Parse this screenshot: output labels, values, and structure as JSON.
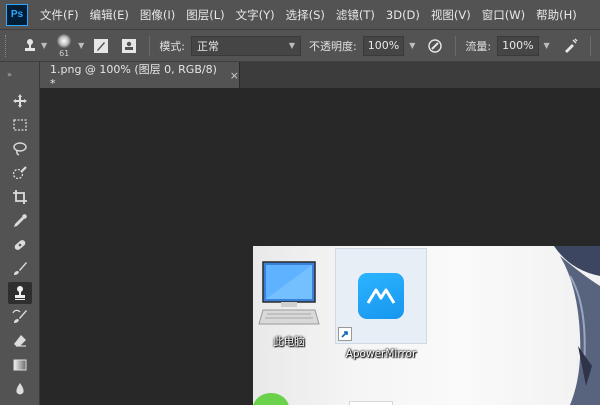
{
  "app": {
    "logo_text": "Ps"
  },
  "menu": [
    {
      "label": "文件(F)"
    },
    {
      "label": "编辑(E)"
    },
    {
      "label": "图像(I)"
    },
    {
      "label": "图层(L)"
    },
    {
      "label": "文字(Y)"
    },
    {
      "label": "选择(S)"
    },
    {
      "label": "滤镜(T)"
    },
    {
      "label": "3D(D)"
    },
    {
      "label": "视图(V)"
    },
    {
      "label": "窗口(W)"
    },
    {
      "label": "帮助(H)"
    }
  ],
  "options": {
    "brush_size": "61",
    "mode_label": "模式:",
    "mode_value": "正常",
    "opacity_label": "不透明度:",
    "opacity_value": "100%",
    "flow_label": "流量:",
    "flow_value": "100%"
  },
  "document_tab": {
    "title": "1.png @ 100% (图层 0, RGB/8) *",
    "close_symbol": "×"
  },
  "toolbar": {
    "collapse_symbol": "»",
    "tools": [
      {
        "name": "move-tool-icon"
      },
      {
        "name": "marquee-tool-icon"
      },
      {
        "name": "lasso-tool-icon"
      },
      {
        "name": "quick-select-tool-icon"
      },
      {
        "name": "crop-tool-icon"
      },
      {
        "name": "eyedropper-tool-icon"
      },
      {
        "name": "healing-brush-tool-icon"
      },
      {
        "name": "brush-tool-icon"
      },
      {
        "name": "clone-stamp-tool-icon",
        "active": true
      },
      {
        "name": "history-brush-tool-icon"
      },
      {
        "name": "eraser-tool-icon"
      },
      {
        "name": "gradient-tool-icon"
      },
      {
        "name": "blur-tool-icon"
      }
    ]
  },
  "canvas": {
    "desktop_icons": [
      {
        "label": "此电脑",
        "icon": "computer-icon"
      },
      {
        "label": "ApowerMirror",
        "icon": "apowermirror-icon"
      }
    ]
  },
  "colors": {
    "ui_panel": "#535353",
    "canvas_bg": "#282828",
    "accent": "#31a8ff",
    "apower_blue": "#1da1f2"
  }
}
